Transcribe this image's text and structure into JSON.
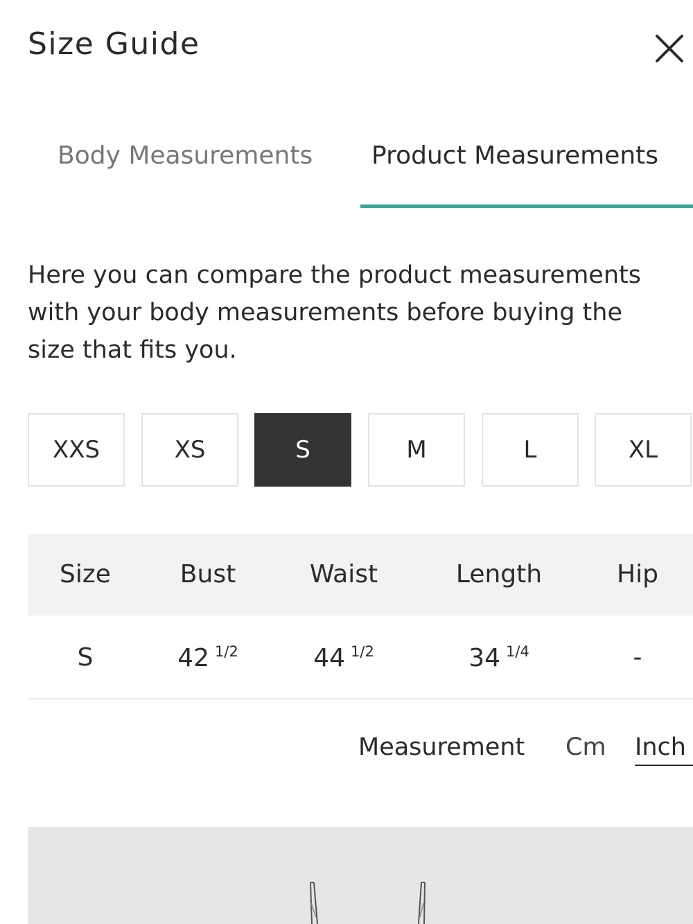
{
  "header": {
    "title": "Size Guide",
    "close_icon": "close-icon"
  },
  "tabs": {
    "items": [
      {
        "label": "Body Measurements",
        "active": false
      },
      {
        "label": "Product Measurements",
        "active": true
      }
    ],
    "active_underline_color": "#3aa597"
  },
  "intro": {
    "text": "Here you can compare the product measurements with your body measurements before buying the size that fits you."
  },
  "sizes": {
    "options": [
      "XXS",
      "XS",
      "S",
      "M",
      "L",
      "XL"
    ],
    "selected": "S",
    "selected_bg_color": "#333333"
  },
  "table": {
    "headers": [
      "Size",
      "Bust",
      "Waist",
      "Length",
      "Hip"
    ],
    "rows": [
      [
        {
          "whole": "S",
          "fraction": ""
        },
        {
          "whole": "42",
          "fraction": "1/2"
        },
        {
          "whole": "44",
          "fraction": "1/2"
        },
        {
          "whole": "34",
          "fraction": "1/4"
        },
        {
          "whole": "-",
          "fraction": ""
        }
      ]
    ],
    "header_bg_color": "#f2f2f2"
  },
  "units": {
    "label": "Measurement",
    "options": [
      "Cm",
      "Inch"
    ],
    "selected": "Inch"
  },
  "product_image": {
    "background_color": "#e6e6e6",
    "content": "garment-straps"
  }
}
